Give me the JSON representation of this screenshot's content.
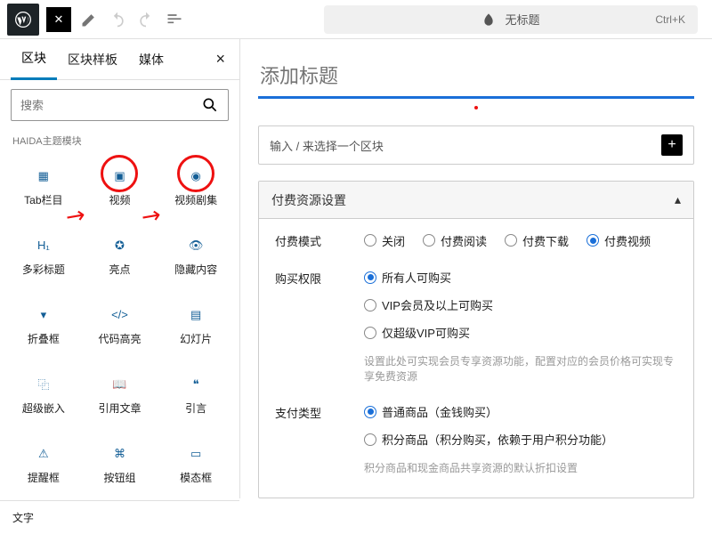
{
  "topbar": {
    "title": "无标题",
    "shortcut": "Ctrl+K"
  },
  "sidebar": {
    "tabs": [
      "区块",
      "区块样板",
      "媒体"
    ],
    "search_placeholder": "搜索",
    "category": "HAIDA主题模块",
    "items": [
      {
        "name": "tab-columns",
        "label": "Tab栏目"
      },
      {
        "name": "video",
        "label": "视频",
        "circled": true,
        "arrow": true
      },
      {
        "name": "video-series",
        "label": "视频剧集",
        "circled": true,
        "arrow": true
      },
      {
        "name": "color-title",
        "label": "多彩标题"
      },
      {
        "name": "highlights",
        "label": "亮点"
      },
      {
        "name": "hidden-content",
        "label": "隐藏内容"
      },
      {
        "name": "accordion",
        "label": "折叠框"
      },
      {
        "name": "code-highlight",
        "label": "代码高亮"
      },
      {
        "name": "slideshow",
        "label": "幻灯片"
      },
      {
        "name": "super-embed",
        "label": "超级嵌入"
      },
      {
        "name": "quote-article",
        "label": "引用文章"
      },
      {
        "name": "quote",
        "label": "引言"
      },
      {
        "name": "alert-box",
        "label": "提醒框"
      },
      {
        "name": "button-group",
        "label": "按钮组"
      },
      {
        "name": "modal-box",
        "label": "模态框"
      }
    ],
    "footer": "文字"
  },
  "canvas": {
    "title_placeholder": "添加标题",
    "block_prompt": "输入 / 来选择一个区块"
  },
  "panel": {
    "title": "付费资源设置",
    "rows": [
      {
        "label": "付费模式",
        "horiz": true,
        "options": [
          {
            "label": "关闭"
          },
          {
            "label": "付费阅读"
          },
          {
            "label": "付费下载"
          },
          {
            "label": "付费视频",
            "on": true
          }
        ]
      },
      {
        "label": "购买权限",
        "options": [
          {
            "label": "所有人可购买",
            "on": true
          },
          {
            "label": "VIP会员及以上可购买"
          },
          {
            "label": "仅超级VIP可购买"
          }
        ],
        "hint": "设置此处可实现会员专享资源功能，配置对应的会员价格可实现专享免费资源"
      },
      {
        "label": "支付类型",
        "options": [
          {
            "label": "普通商品（金钱购买）",
            "on": true
          },
          {
            "label": "积分商品（积分购买，依赖于用户积分功能）"
          }
        ],
        "hint": "积分商品和现金商品共享资源的默认折扣设置"
      }
    ]
  }
}
